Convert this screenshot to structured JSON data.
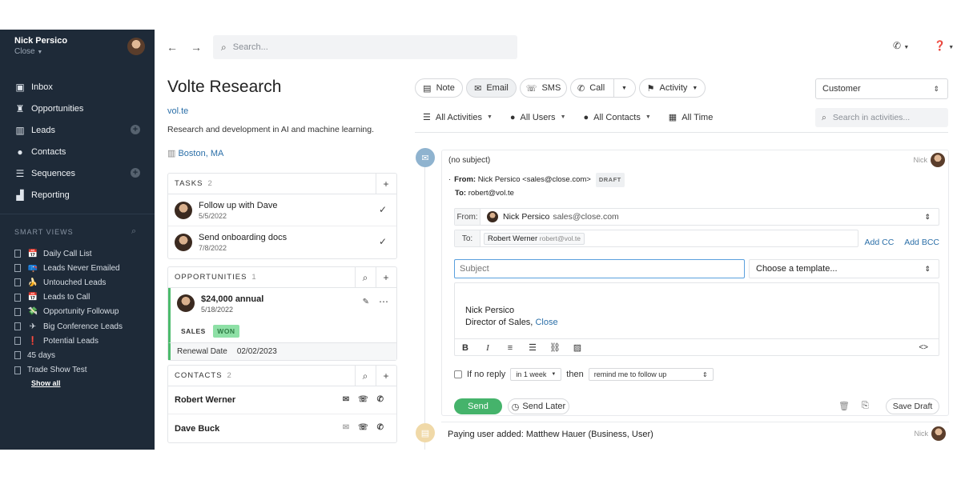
{
  "sidebar": {
    "user_name": "Nick Persico",
    "org": "Close",
    "nav": [
      {
        "label": "Inbox",
        "icon": "inbox-icon",
        "glyph": "▣"
      },
      {
        "label": "Opportunities",
        "icon": "trophy-icon",
        "glyph": "♜"
      },
      {
        "label": "Leads",
        "icon": "building-icon",
        "glyph": "▥",
        "plus": true
      },
      {
        "label": "Contacts",
        "icon": "person-icon",
        "glyph": "●"
      },
      {
        "label": "Sequences",
        "icon": "list-icon",
        "glyph": "☰",
        "plus": true
      },
      {
        "label": "Reporting",
        "icon": "chart-icon",
        "glyph": "▟"
      }
    ],
    "smart_views_title": "SMART VIEWS",
    "smart_views": [
      {
        "label": "Daily Call List",
        "emoji": "📅"
      },
      {
        "label": "Leads Never Emailed",
        "emoji": "📪"
      },
      {
        "label": "Untouched Leads",
        "emoji": "🍌"
      },
      {
        "label": "Leads to Call",
        "emoji": "📅"
      },
      {
        "label": "Opportunity Followup",
        "emoji": "💸"
      },
      {
        "label": "Big Conference Leads",
        "emoji": "✈"
      },
      {
        "label": "Potential Leads",
        "emoji": "❗"
      },
      {
        "label": "45 days",
        "emoji": ""
      },
      {
        "label": "Trade Show Test",
        "emoji": ""
      }
    ],
    "show_all": "Show all"
  },
  "topbar": {
    "search_placeholder": "Search..."
  },
  "lead": {
    "name": "Volte Research",
    "url": "vol.te",
    "description": "Research and development in AI and machine learning.",
    "location": "Boston, MA"
  },
  "tasks": {
    "title": "TASKS",
    "count": "2",
    "items": [
      {
        "title": "Follow up with Dave",
        "date": "5/5/2022"
      },
      {
        "title": "Send onboarding docs",
        "date": "7/8/2022"
      }
    ]
  },
  "opportunities": {
    "title": "OPPORTUNITIES",
    "count": "1",
    "value": "$24,000 annual",
    "date": "5/18/2022",
    "pipeline": "SALES",
    "status": "WON",
    "renewal_label": "Renewal Date",
    "renewal_date": "02/02/2023"
  },
  "contacts": {
    "title": "CONTACTS",
    "count": "2",
    "items": [
      {
        "name": "Robert Werner"
      },
      {
        "name": "Dave Buck"
      }
    ]
  },
  "actions": {
    "note": "Note",
    "email": "Email",
    "sms": "SMS",
    "call": "Call",
    "activity": "Activity",
    "status_select": "Customer"
  },
  "filters": {
    "activities": "All Activities",
    "users": "All Users",
    "contacts": "All Contacts",
    "time": "All Time",
    "search_placeholder": "Search in activities..."
  },
  "email": {
    "subject": "(no subject)",
    "author": "Nick",
    "from_label": "From:",
    "from_value": "Nick Persico <sales@close.com>",
    "draft": "DRAFT",
    "to_label": "To:",
    "to_value": "robert@vol.te",
    "compose_from_label": "From:",
    "compose_from_name": "Nick Persico",
    "compose_from_email": "sales@close.com",
    "compose_to_label": "To:",
    "recipient_name": "Robert Werner",
    "recipient_email": "robert@vol.te",
    "add_cc": "Add CC",
    "add_bcc": "Add BCC",
    "subject_placeholder": "Subject",
    "template_placeholder": "Choose a template...",
    "signature_name": "Nick Persico",
    "signature_title": "Director of Sales,",
    "signature_company": "Close",
    "if_no_reply": "If no reply",
    "interval": "in 1 week",
    "then": "then",
    "followup_action": "remind me to follow up",
    "send": "Send",
    "send_later": "Send Later",
    "save_draft": "Save Draft"
  },
  "note": {
    "text": "Paying user added: Matthew Hauer (Business, User)",
    "author": "Nick"
  },
  "colors": {
    "sidebar_bg": "#1e2a38",
    "accent_green": "#45b36b",
    "link_blue": "#2b6fa8"
  }
}
